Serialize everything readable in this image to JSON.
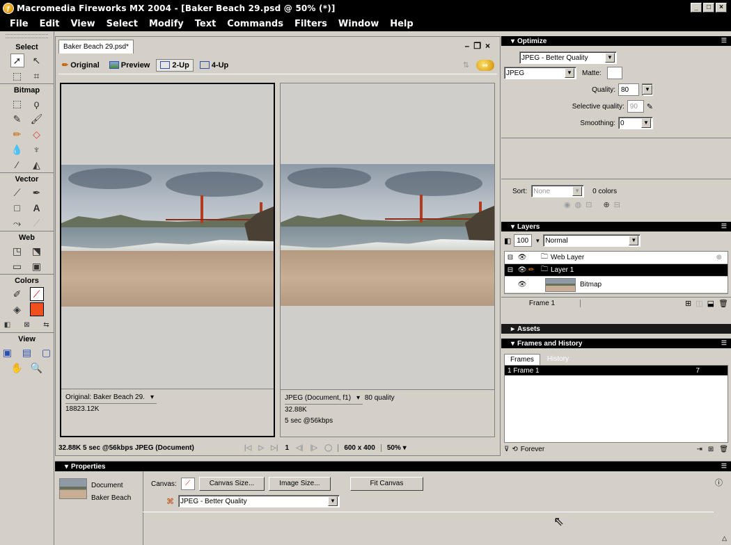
{
  "window": {
    "title": "Macromedia Fireworks MX 2004 - [Baker Beach 29.psd @ 50% (*)]"
  },
  "menu": [
    "File",
    "Edit",
    "View",
    "Select",
    "Modify",
    "Text",
    "Commands",
    "Filters",
    "Window",
    "Help"
  ],
  "tools": {
    "sections": {
      "select": "Select",
      "bitmap": "Bitmap",
      "vector": "Vector",
      "web": "Web",
      "colors": "Colors",
      "view": "View"
    }
  },
  "document": {
    "tab": "Baker Beach 29.psd*",
    "views": {
      "original": "Original",
      "preview": "Preview",
      "two_up": "2-Up",
      "four_up": "4-Up"
    },
    "left_pane": {
      "label": "Original: Baker Beach 29.",
      "size": "18823.12K"
    },
    "right_pane": {
      "format": "JPEG (Document, f1)",
      "quality": "80 quality",
      "size": "32.88K",
      "time": "5 sec @56kbps"
    },
    "status": {
      "summary": "32.88K  5 sec @56kbps  JPEG (Document)",
      "frame": "1",
      "dimensions": "600 x 400",
      "zoom": "50%"
    }
  },
  "optimize": {
    "title": "Optimize",
    "preset": "JPEG - Better Quality",
    "format": "JPEG",
    "matte_label": "Matte:",
    "quality_label": "Quality:",
    "quality_value": "80",
    "selective_label": "Selective quality:",
    "selective_value": "90",
    "smoothing_label": "Smoothing:",
    "smoothing_value": "0",
    "sort_label": "Sort:",
    "sort_value": "None",
    "colors": "0 colors"
  },
  "layers": {
    "title": "Layers",
    "opacity": "100",
    "blend": "Normal",
    "rows": [
      {
        "name": "Web Layer"
      },
      {
        "name": "Layer 1"
      },
      {
        "name": "Bitmap"
      }
    ],
    "frame": "Frame 1"
  },
  "assets": {
    "title": "Assets"
  },
  "frames": {
    "title": "Frames and History",
    "tabs": [
      "Frames",
      "History"
    ],
    "row_label": "1  Frame 1",
    "row_delay": "7",
    "loop": "Forever"
  },
  "properties": {
    "title": "Properties",
    "doc_type": "Document",
    "doc_name": "Baker Beach",
    "canvas_label": "Canvas:",
    "canvas_size": "Canvas Size...",
    "image_size": "Image Size...",
    "fit_canvas": "Fit Canvas",
    "export_setting": "JPEG - Better Quality"
  }
}
